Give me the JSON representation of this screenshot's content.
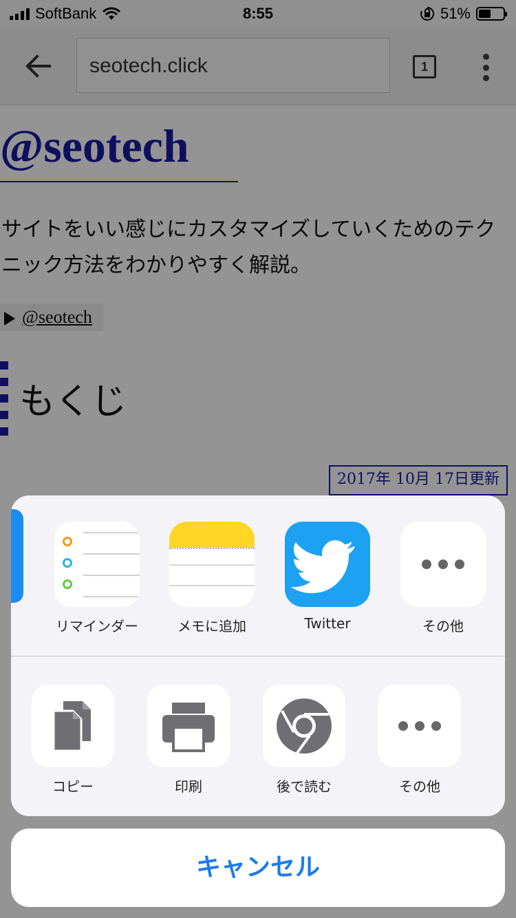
{
  "status_bar": {
    "carrier": "SoftBank",
    "time": "8:55",
    "battery": "51%",
    "battery_level": 0.51
  },
  "browser": {
    "url": "seotech.click",
    "tab_count": "1"
  },
  "page": {
    "site_title": "@seotech",
    "description": "サイトをいい感じにカスタマイズしていくためのテクニック方法をわかりやすく解説。",
    "toggle_link": "@seotech",
    "toc_heading": "もくじ",
    "updated": "2017年 10月 17日更新"
  },
  "share_sheet": {
    "apps": [
      {
        "label": "リマインダー",
        "icon": "reminders-icon"
      },
      {
        "label": "メモに追加",
        "icon": "notes-icon"
      },
      {
        "label": "Twitter",
        "icon": "twitter-icon"
      },
      {
        "label": "その他",
        "icon": "more-icon"
      }
    ],
    "actions": [
      {
        "label": "コピー",
        "icon": "copy-icon"
      },
      {
        "label": "印刷",
        "icon": "print-icon"
      },
      {
        "label": "後で読む",
        "icon": "chrome-icon"
      },
      {
        "label": "その他",
        "icon": "more-icon"
      }
    ],
    "cancel_label": "キャンセル"
  },
  "colors": {
    "accent": "#1a7ce8",
    "link_blue": "#1a1aa6",
    "twitter": "#1da1f2",
    "notes_yellow": "#ffd526"
  }
}
